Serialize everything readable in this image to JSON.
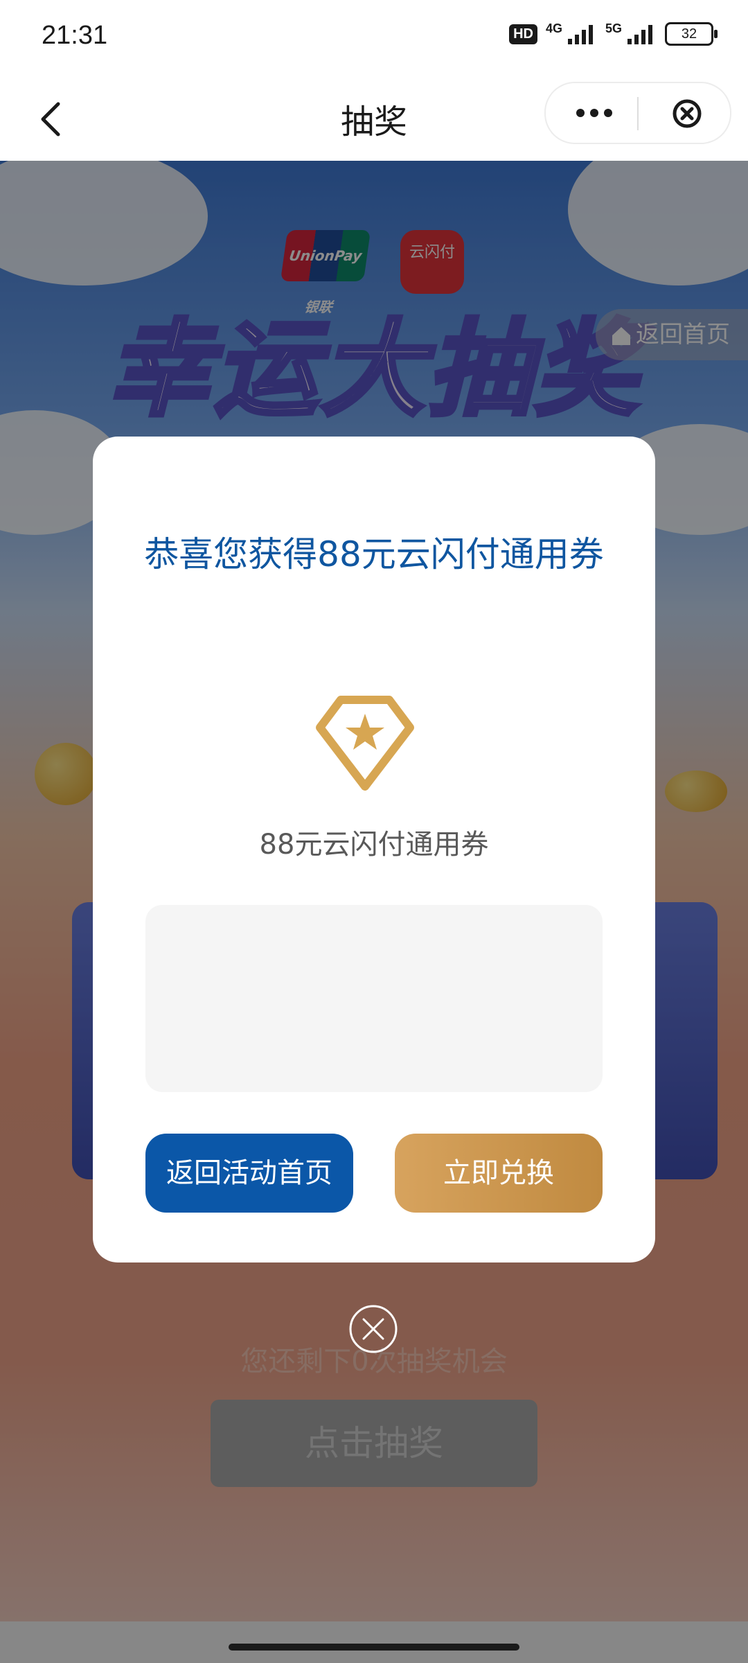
{
  "status_bar": {
    "time": "21:31",
    "hd_badge": "HD",
    "net1": "4G",
    "net2": "5G",
    "battery": "32"
  },
  "nav": {
    "title": "抽奖",
    "back_icon": "chevron-left-icon",
    "more_icon": "more-dots-icon",
    "close_icon": "close-circle-icon"
  },
  "scene": {
    "unionpay_logo": "UnionPay银联",
    "cloudpay_logo": "云闪付",
    "big_title": "幸运大抽奖",
    "home_return": "返回首页",
    "chances_text": "您还剩下0次抽奖机会",
    "draw_button": "点击抽奖"
  },
  "modal": {
    "title": "恭喜您获得88元云闪付通用券",
    "prize_icon": "diamond-star-icon",
    "prize_name": "88元云闪付通用券",
    "back_button": "返回活动首页",
    "redeem_button": "立即兑换",
    "close_icon": "close-circle-icon"
  },
  "colors": {
    "primary_blue": "#0b57a8",
    "gold": "#c8954e",
    "title_blue": "#0f56a0"
  }
}
